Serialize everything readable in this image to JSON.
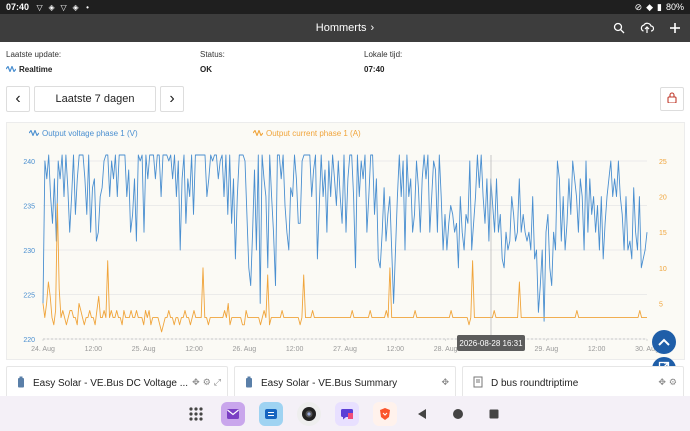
{
  "status_bar": {
    "time": "07:40",
    "battery": "80%"
  },
  "appbar": {
    "title": "Hommerts",
    "chevron": "›",
    "icons": [
      "search-icon",
      "cloud-upload-icon",
      "plus-icon"
    ]
  },
  "info": {
    "last_update_label": "Laatste update:",
    "last_update_value": "Realtime",
    "status_label": "Status:",
    "status_value": "OK",
    "local_time_label": "Lokale tijd:",
    "local_time_value": "07:40"
  },
  "range": {
    "prev": "‹",
    "label": "Laatste 7 dagen",
    "next": "›"
  },
  "chart_data": {
    "type": "line",
    "series": [
      {
        "name": "Output voltage phase 1 (V)",
        "axis": "left",
        "color": "#4a8fd0",
        "values": [
          224,
          240,
          238,
          242,
          236,
          233,
          238,
          231,
          240,
          238,
          244,
          236,
          246,
          237,
          232,
          236,
          246,
          234,
          238,
          244,
          246,
          250,
          238,
          234,
          241,
          232,
          237,
          238,
          231,
          232,
          236,
          237,
          240,
          242,
          244,
          236,
          240,
          238,
          246,
          236,
          243,
          242,
          248,
          246,
          236,
          239,
          232,
          234,
          238,
          231,
          243,
          240,
          245,
          232,
          244,
          238,
          247,
          242,
          244,
          238,
          252,
          250,
          236,
          246,
          247,
          248,
          240,
          244,
          238,
          243,
          236,
          240,
          230,
          238,
          241,
          233,
          238,
          236,
          246,
          234,
          243,
          241,
          249,
          244,
          242,
          244,
          236,
          238,
          247,
          240,
          243,
          242,
          238,
          240,
          247,
          236,
          244,
          234,
          241,
          233,
          238,
          229,
          236,
          242,
          245,
          246,
          240,
          234,
          228,
          226,
          232,
          239,
          230,
          242,
          224,
          245,
          238,
          236,
          228,
          242,
          236,
          232,
          226,
          244,
          243,
          238,
          246,
          235,
          232,
          230,
          237,
          236,
          242,
          238,
          233,
          233,
          240,
          246,
          242,
          248,
          244,
          236,
          239,
          243,
          229,
          235,
          243,
          236,
          239,
          232,
          240,
          236,
          244,
          238,
          235,
          240,
          236,
          233,
          244,
          232,
          238,
          241,
          243,
          236,
          228,
          244,
          236,
          240,
          238,
          244,
          232,
          236,
          246,
          242,
          234,
          238,
          229,
          228,
          232,
          237,
          231,
          234,
          236,
          230,
          224,
          230,
          236,
          242,
          236,
          240,
          230,
          246,
          236,
          238,
          232,
          234,
          240,
          237,
          232,
          238,
          244,
          238,
          246,
          232,
          236,
          240,
          239,
          232,
          244,
          236,
          230,
          234,
          230,
          233,
          235,
          234,
          232,
          233,
          228,
          236,
          232,
          230,
          234,
          233,
          240,
          230,
          233,
          236,
          241,
          237,
          242,
          236,
          233,
          238,
          231,
          238,
          235,
          232,
          238,
          232,
          234,
          229,
          228,
          232,
          230,
          231,
          236,
          234,
          231,
          232,
          238,
          232,
          234,
          232,
          231,
          232,
          230,
          236,
          229,
          230,
          223,
          226,
          230,
          222,
          232,
          234,
          228,
          226,
          232,
          230,
          240,
          238,
          231,
          236,
          230,
          233,
          238,
          234,
          240,
          238,
          236,
          232,
          238,
          236,
          230,
          240,
          232,
          238,
          234,
          236,
          232,
          235,
          230,
          236,
          229,
          233,
          236,
          238,
          240,
          236,
          238,
          236,
          240,
          236,
          234,
          230,
          236,
          230,
          231,
          229,
          237,
          232,
          230,
          236,
          228,
          229,
          230,
          232
        ]
      },
      {
        "name": "Output current phase 1 (A)",
        "axis": "right",
        "color": "#f0a43a",
        "values": [
          5,
          3,
          5,
          8,
          6,
          3,
          2,
          4,
          19,
          7,
          3,
          4,
          3,
          2,
          3,
          4,
          4,
          3,
          3,
          2,
          5,
          4,
          3,
          2,
          3,
          3,
          4,
          3,
          3,
          2,
          4,
          6,
          3,
          3,
          4,
          3,
          11,
          3,
          4,
          3,
          3,
          4,
          3,
          3,
          2,
          4,
          3,
          3,
          3,
          4,
          3,
          3,
          4,
          3,
          3,
          3,
          2,
          4,
          3,
          4,
          2,
          3,
          3,
          3,
          3,
          2,
          1,
          2,
          3,
          3,
          4,
          3,
          3,
          2,
          3,
          3,
          2,
          3,
          3,
          4,
          3,
          3,
          2,
          3,
          4,
          3,
          3,
          3,
          3,
          10,
          3,
          3,
          2,
          3,
          3,
          3,
          3,
          3,
          3,
          3,
          3,
          4,
          3,
          5,
          2,
          3,
          3,
          3,
          3,
          3,
          3,
          2,
          2,
          4,
          3,
          3,
          3,
          3,
          3,
          3,
          3,
          2,
          3,
          4,
          3,
          9,
          2,
          3,
          3,
          3,
          3,
          3,
          3,
          4,
          3,
          3,
          3,
          3,
          3,
          3,
          3,
          3,
          3,
          2,
          3,
          9,
          3,
          3,
          3,
          3,
          4,
          3,
          3,
          3,
          3,
          3,
          3,
          3,
          3,
          3,
          3,
          3,
          3,
          3,
          3,
          3,
          3,
          3,
          3,
          3,
          3,
          3,
          4,
          3,
          3,
          3,
          3,
          3,
          3,
          3,
          3,
          3,
          4,
          3,
          3,
          3,
          3,
          3,
          3,
          3,
          3,
          4,
          3,
          10,
          3,
          3,
          3,
          3,
          3,
          3,
          3,
          3,
          3,
          3,
          3,
          3,
          3,
          4,
          3,
          3,
          3,
          3,
          3,
          3,
          3,
          3,
          3,
          3,
          3,
          3,
          3,
          3,
          3,
          3,
          3,
          3,
          3,
          4,
          3,
          3,
          3,
          3,
          3,
          3,
          3,
          3,
          3,
          2,
          3,
          11,
          3,
          3,
          3,
          3,
          3,
          3,
          3,
          3,
          3,
          3,
          3,
          4,
          3,
          3,
          3,
          3,
          3,
          3,
          3,
          3,
          3,
          3,
          3,
          3,
          3,
          8,
          3,
          3,
          3,
          3,
          3,
          3,
          3,
          3,
          3,
          3,
          3,
          3,
          3,
          3,
          3,
          3,
          3,
          3,
          3,
          3,
          3,
          3,
          3,
          3,
          3,
          3,
          3,
          3,
          3,
          3,
          3,
          4,
          3,
          3,
          3,
          3,
          3,
          3,
          3,
          3,
          3,
          3,
          3,
          3,
          3,
          3,
          3,
          3,
          3,
          3,
          3,
          3,
          3,
          3,
          3,
          3,
          3,
          3,
          3,
          3,
          3,
          3,
          3,
          3,
          3,
          3,
          4,
          3,
          3,
          3,
          3
        ]
      }
    ],
    "left_axis": {
      "ticks": [
        "240",
        "235",
        "230",
        "225",
        "220"
      ],
      "ylim": [
        220,
        240
      ]
    },
    "right_axis": {
      "ticks": [
        "25",
        "20",
        "15",
        "10",
        "5",
        "0"
      ],
      "ylim": [
        0,
        25
      ]
    },
    "x_ticks": [
      "24. Aug",
      "12:00",
      "25. Aug",
      "12:00",
      "26. Aug",
      "12:00",
      "27. Aug",
      "12:00",
      "28. Aug",
      "12:00",
      "29. Aug",
      "12:00",
      "30. Aug"
    ],
    "cursor_label": "2026-08-28 16:31",
    "grid": true,
    "legend_position": "top"
  },
  "cards": [
    {
      "title": "Easy Solar - VE.Bus DC Voltage ...",
      "icon": "battery-icon"
    },
    {
      "title": "Easy Solar - VE.Bus Summary",
      "icon": "battery-icon"
    },
    {
      "title": "D bus roundtriptime",
      "icon": "document-icon"
    }
  ]
}
